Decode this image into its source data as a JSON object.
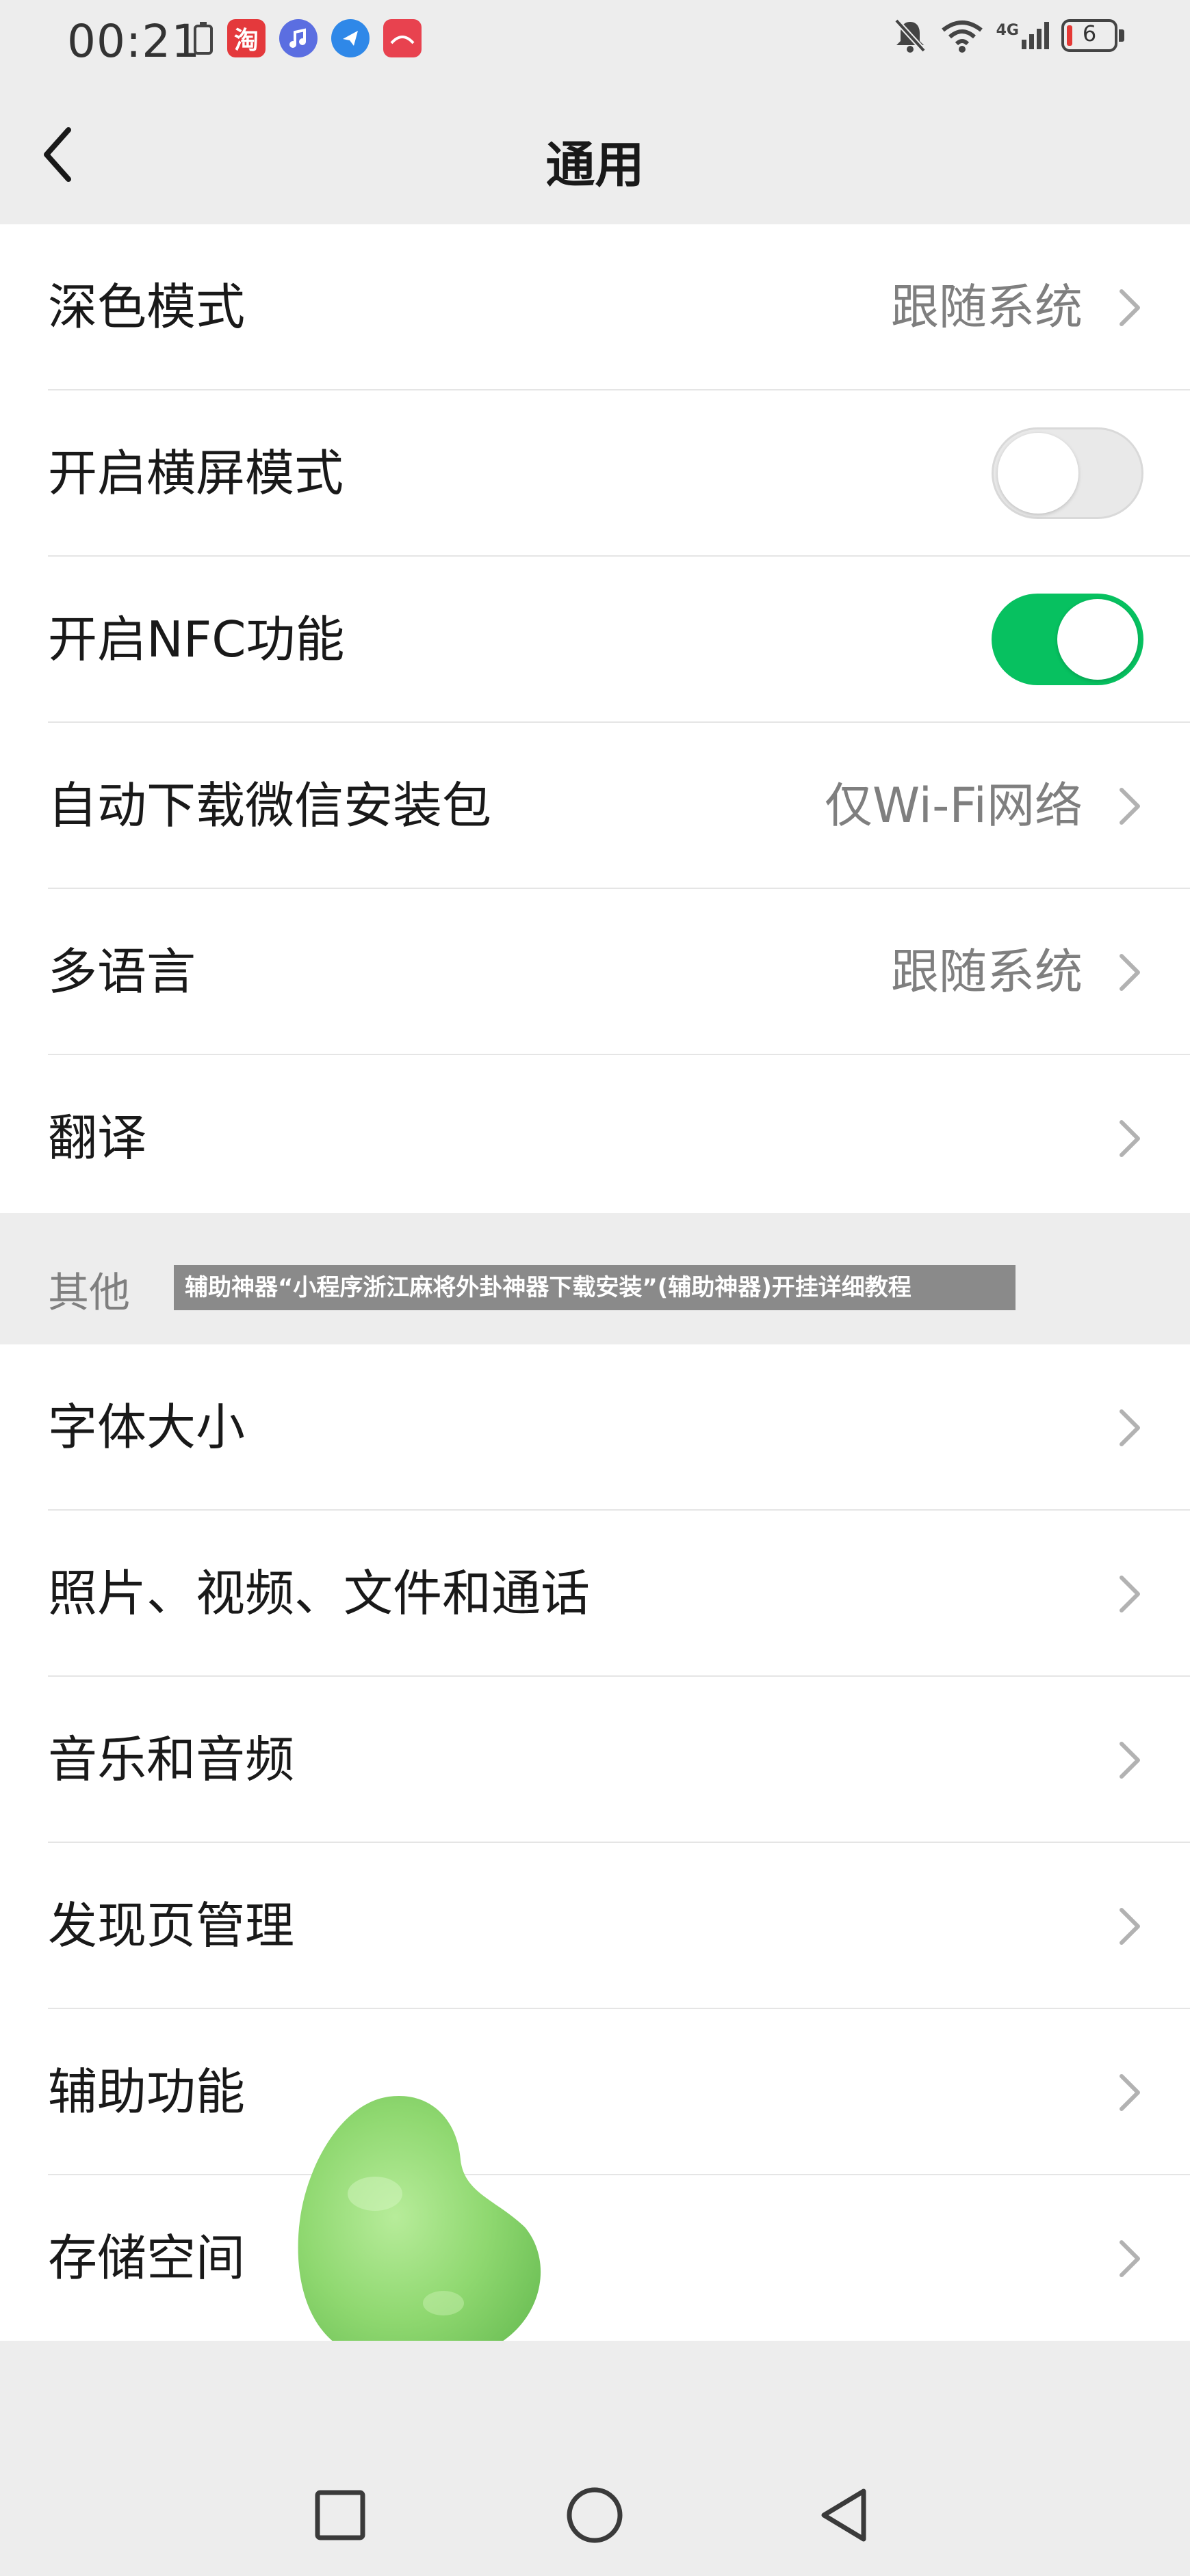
{
  "status_bar": {
    "time": "00:21",
    "left_icons": [
      "battery-saver-icon",
      "taobao-app-icon",
      "music-app-icon",
      "messenger-app-icon",
      "huawei-app-icon"
    ],
    "taobao_glyph": "淘",
    "right_icons": [
      "mute-bell-icon",
      "wifi-icon",
      "4g-signal-icon",
      "battery-icon"
    ],
    "network": "4G",
    "battery_level": "6"
  },
  "header": {
    "title": "通用"
  },
  "settings": [
    {
      "label": "深色模式",
      "value": "跟随系统",
      "type": "link"
    },
    {
      "label": "开启横屏模式",
      "type": "toggle",
      "on": false
    },
    {
      "label": "开启NFC功能",
      "type": "toggle",
      "on": true
    },
    {
      "label": "自动下载微信安装包",
      "value": "仅Wi-Fi网络",
      "type": "link"
    },
    {
      "label": "多语言",
      "value": "跟随系统",
      "type": "link"
    },
    {
      "label": "翻译",
      "value": "",
      "type": "link"
    }
  ],
  "other_section": {
    "header": "其他",
    "items": [
      {
        "label": "字体大小"
      },
      {
        "label": "照片、视频、文件和通话"
      },
      {
        "label": "音乐和音频"
      },
      {
        "label": "发现页管理"
      },
      {
        "label": "辅助功能"
      },
      {
        "label": "存储空间"
      }
    ]
  },
  "overlay_banner": "辅助神器“小程序浙江麻将外卦神器下载安装”(辅助神器)开挂详细教程",
  "colors": {
    "background": "#ededed",
    "card": "#ffffff",
    "accent_green": "#07c160",
    "secondary_text": "#7f7f7f"
  },
  "bottom_nav": [
    "recent-apps-icon",
    "home-icon",
    "back-triangle-icon"
  ]
}
